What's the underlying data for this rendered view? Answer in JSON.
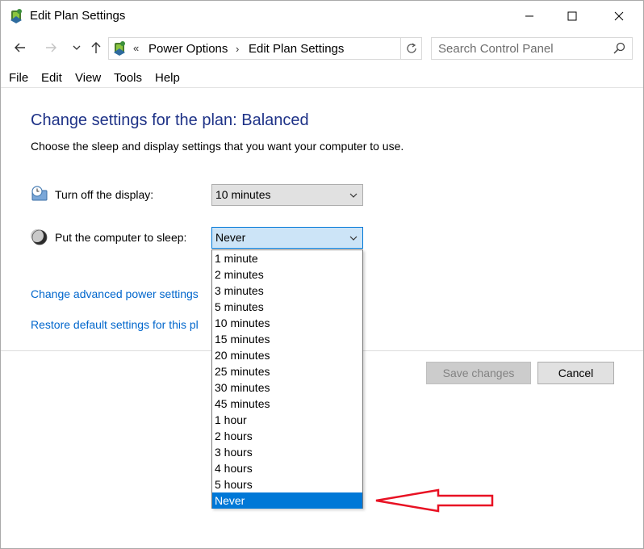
{
  "window": {
    "title": "Edit Plan Settings",
    "title_icon": "power-options-icon"
  },
  "address": {
    "overflow_chevron": "«",
    "crumbs": [
      "Power Options",
      "Edit Plan Settings"
    ],
    "separator": "›",
    "search_placeholder": "Search Control Panel"
  },
  "menu": [
    "File",
    "Edit",
    "View",
    "Tools",
    "Help"
  ],
  "content": {
    "heading": "Change settings for the plan: Balanced",
    "subtext": "Choose the sleep and display settings that you want your computer to use.",
    "display_label": "Turn off the display:",
    "display_value": "10 minutes",
    "sleep_label": "Put the computer to sleep:",
    "sleep_value": "Never",
    "link_advanced": "Change advanced power settings",
    "link_restore": "Restore default settings for this pl",
    "save_label": "Save changes",
    "cancel_label": "Cancel"
  },
  "dropdown": {
    "options": [
      "1 minute",
      "2 minutes",
      "3 minutes",
      "5 minutes",
      "10 minutes",
      "15 minutes",
      "20 minutes",
      "25 minutes",
      "30 minutes",
      "45 minutes",
      "1 hour",
      "2 hours",
      "3 hours",
      "4 hours",
      "5 hours",
      "Never"
    ],
    "selected_index": 15
  },
  "colors": {
    "heading": "#1e3287",
    "link": "#0066cc",
    "selection": "#0078d7",
    "annotation_arrow": "#e81123"
  }
}
